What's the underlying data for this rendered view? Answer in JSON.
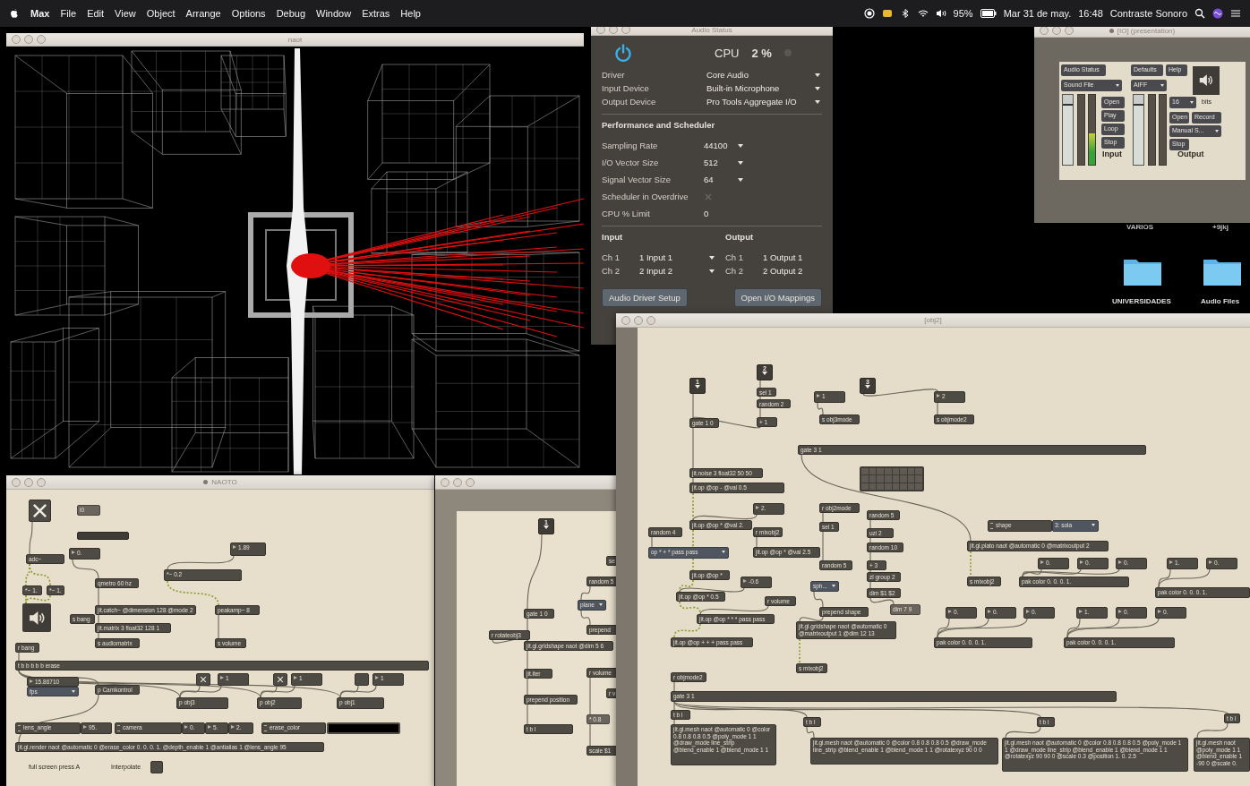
{
  "menu_bar": {
    "app": "Max",
    "menus": [
      "File",
      "Edit",
      "View",
      "Object",
      "Arrange",
      "Options",
      "Debug",
      "Window",
      "Extras",
      "Help"
    ],
    "battery": "95%",
    "date": "Mar 31 de may.",
    "time": "16:48",
    "user": "Contraste Sonoro"
  },
  "render_window": {
    "title": "naot"
  },
  "audio_status": {
    "title": "Audio Status",
    "power_on": true,
    "cpu_label": "CPU",
    "cpu_value": "2 %",
    "settings": [
      {
        "label": "Driver",
        "value": "Core Audio"
      },
      {
        "label": "Input Device",
        "value": "Built-in Microphone"
      },
      {
        "label": "Output Device",
        "value": "Pro Tools Aggregate I/O"
      }
    ],
    "section": "Performance and Scheduler",
    "perf": [
      {
        "kind": "menu",
        "label": "Sampling Rate",
        "value": "44100"
      },
      {
        "kind": "menu",
        "label": "I/O Vector Size",
        "value": "512"
      },
      {
        "kind": "menu",
        "label": "Signal Vector Size",
        "value": "64"
      },
      {
        "kind": "checkbox",
        "label": "Scheduler in Overdrive",
        "checked": true
      },
      {
        "kind": "number",
        "label": "CPU % Limit",
        "value": "0"
      }
    ],
    "io": [
      {
        "label": "Input",
        "channels": [
          {
            "ch": "Ch 1",
            "value": "1 Input 1"
          },
          {
            "ch": "Ch 2",
            "value": "2 Input 2"
          }
        ]
      },
      {
        "label": "Output",
        "channels": [
          {
            "ch": "Ch 1",
            "value": "1 Output 1"
          },
          {
            "ch": "Ch 2",
            "value": "2 Output 2"
          }
        ]
      }
    ],
    "buttons": [
      "Audio Driver Setup",
      "Open I/O Mappings"
    ]
  },
  "presentation": {
    "title": "[IO] (presentation)",
    "modified": true,
    "items": [
      {
        "kind": "button",
        "text": "Audio Status"
      },
      {
        "kind": "menu",
        "text": "Sound File"
      },
      {
        "kind": "button",
        "text": "Defaults"
      },
      {
        "kind": "button",
        "text": "Help"
      },
      {
        "kind": "menu",
        "text": "AIFF"
      },
      {
        "kind": "ezdac"
      },
      {
        "kind": "button",
        "text": "Open"
      },
      {
        "kind": "button",
        "text": "Play"
      },
      {
        "kind": "button",
        "text": "Loop"
      },
      {
        "kind": "button",
        "text": "Stop"
      },
      {
        "kind": "label",
        "text": "Input"
      },
      {
        "kind": "menu",
        "text": "16"
      },
      {
        "kind": "label",
        "text": "bits"
      },
      {
        "kind": "button",
        "text": "Open"
      },
      {
        "kind": "button",
        "text": "Record"
      },
      {
        "kind": "menu",
        "text": "Manual S..."
      },
      {
        "kind": "button",
        "text": "Stop"
      },
      {
        "kind": "label",
        "text": "Output"
      },
      {
        "kind": "gain",
        "level": 0.85
      },
      {
        "kind": "meter",
        "level": 0
      },
      {
        "kind": "meter",
        "level": 0.45
      },
      {
        "kind": "gain",
        "level": 0.85
      },
      {
        "kind": "meter",
        "level": 0
      },
      {
        "kind": "meter",
        "level": 0
      }
    ]
  },
  "desktop_items": [
    {
      "kind": "label",
      "text": "VARIOS"
    },
    {
      "kind": "label",
      "text": "+9jkj"
    },
    {
      "kind": "folder",
      "text": "UNIVERSIDADES"
    },
    {
      "kind": "folder",
      "text": "Audio Files"
    }
  ],
  "naoto": {
    "title": "NAOTO",
    "modified": true,
    "objects": [
      {
        "kind": "toggle",
        "checked": true
      },
      {
        "kind": "message",
        "text": "i0"
      },
      {
        "kind": "slider",
        "level": 0
      },
      {
        "kind": "number",
        "text": "0."
      },
      {
        "kind": "object",
        "text": "adc~"
      },
      {
        "kind": "object",
        "text": "*~ 1."
      },
      {
        "kind": "object",
        "text": "*~ 1."
      },
      {
        "kind": "ezdac"
      },
      {
        "kind": "number",
        "text": "1.89"
      },
      {
        "kind": "object",
        "text": "*~ 0.2"
      },
      {
        "kind": "object",
        "text": "qmetro 60 hz"
      },
      {
        "kind": "object",
        "text": "s bang"
      },
      {
        "kind": "object",
        "text": "jit.catch~ @dimension 128 @mode 2"
      },
      {
        "kind": "object",
        "text": "jit.matrix 3 float32 128 1"
      },
      {
        "kind": "object",
        "text": "s audiomatrix"
      },
      {
        "kind": "object",
        "text": "peakamp~ 8"
      },
      {
        "kind": "object",
        "text": "s volume"
      },
      {
        "kind": "object",
        "text": "r bang"
      },
      {
        "kind": "object",
        "text": "t b b b b b erase"
      },
      {
        "kind": "number",
        "text": "15.86710"
      },
      {
        "kind": "menu",
        "text": "fps"
      },
      {
        "kind": "object",
        "text": "p Camkontrol"
      },
      {
        "kind": "toggle",
        "checked": true
      },
      {
        "kind": "number",
        "text": "1"
      },
      {
        "kind": "object",
        "text": "p obj3"
      },
      {
        "kind": "toggle",
        "checked": true
      },
      {
        "kind": "number",
        "text": "1"
      },
      {
        "kind": "object",
        "text": "p obj2"
      },
      {
        "kind": "toggle",
        "checked": false
      },
      {
        "kind": "number",
        "text": "1"
      },
      {
        "kind": "object",
        "text": "p obj1"
      },
      {
        "kind": "attrui",
        "text": "lens_angle"
      },
      {
        "kind": "number",
        "text": "95."
      },
      {
        "kind": "attrui",
        "text": "camera"
      },
      {
        "kind": "number",
        "text": "0."
      },
      {
        "kind": "number",
        "text": "5."
      },
      {
        "kind": "number",
        "text": "2."
      },
      {
        "kind": "attrui",
        "text": "erase_color"
      },
      {
        "kind": "swatch"
      },
      {
        "kind": "object",
        "text": "jit.gl.render naot @automatic 0 @erase_color 0. 0. 0. 1. @depth_enable 1 @antialias 1 @lens_angle 95"
      },
      {
        "kind": "comment",
        "text": "full screen press A"
      },
      {
        "kind": "comment",
        "text": "Interpolate"
      },
      {
        "kind": "toggle",
        "checked": false
      }
    ]
  },
  "patcher_3": {
    "objects": [
      {
        "kind": "inlet",
        "text": "1"
      },
      {
        "kind": "object",
        "text": "se"
      },
      {
        "kind": "object",
        "text": "random 5"
      },
      {
        "kind": "menu",
        "text": "plane"
      },
      {
        "kind": "object",
        "text": "prepend"
      },
      {
        "kind": "object",
        "text": "gate 1 0"
      },
      {
        "kind": "object",
        "text": "r rotateobj3"
      },
      {
        "kind": "object",
        "text": "jit.gl.gridshape naot @dim 5 6"
      },
      {
        "kind": "object",
        "text": "jit.iter"
      },
      {
        "kind": "object",
        "text": "r volume"
      },
      {
        "kind": "object",
        "text": "r v"
      },
      {
        "kind": "object",
        "text": "prepend position"
      },
      {
        "kind": "message",
        "text": "* 0.8"
      },
      {
        "kind": "object",
        "text": "t b l"
      },
      {
        "kind": "object",
        "text": "scale $1"
      }
    ]
  },
  "obj2": {
    "title": "[obj2]",
    "objects": [
      {
        "kind": "inlet",
        "text": "1"
      },
      {
        "kind": "inlet",
        "text": "2"
      },
      {
        "kind": "inlet",
        "text": "3"
      },
      {
        "kind": "object",
        "text": "sel 1"
      },
      {
        "kind": "object",
        "text": "random 2"
      },
      {
        "kind": "object",
        "text": "gate 1 0"
      },
      {
        "kind": "object",
        "text": "+ 1"
      },
      {
        "kind": "number",
        "text": "1"
      },
      {
        "kind": "object",
        "text": "s obj3mode"
      },
      {
        "kind": "number",
        "text": "2"
      },
      {
        "kind": "object",
        "text": "s objmode2"
      },
      {
        "kind": "object",
        "text": "gate 3 1"
      },
      {
        "kind": "object",
        "text": "jit.noise 3 float32 50 50"
      },
      {
        "kind": "object",
        "text": "jit.op @op - @val 0.5"
      },
      {
        "kind": "matrix"
      },
      {
        "kind": "number",
        "text": "2."
      },
      {
        "kind": "object",
        "text": "r obj2mode"
      },
      {
        "kind": "object",
        "text": "random 5"
      },
      {
        "kind": "object",
        "text": "jit.op @op * @val 2."
      },
      {
        "kind": "object",
        "text": "random 4"
      },
      {
        "kind": "object",
        "text": "r mixobj2"
      },
      {
        "kind": "object",
        "text": "sel 1"
      },
      {
        "kind": "object",
        "text": "uzi 2"
      },
      {
        "kind": "attrui",
        "text": "shape"
      },
      {
        "kind": "menu",
        "text": "3: sola"
      },
      {
        "kind": "object",
        "text": "random 10"
      },
      {
        "kind": "object",
        "text": "jit.gl.plato naot @automatic 0 @matrixoutput 2"
      },
      {
        "kind": "menu",
        "text": "op * + * pass pass"
      },
      {
        "kind": "object",
        "text": "jit.op @op * @val 2.5"
      },
      {
        "kind": "object",
        "text": "random 5"
      },
      {
        "kind": "object",
        "text": "+ 3"
      },
      {
        "kind": "number",
        "text": "0."
      },
      {
        "kind": "number",
        "text": "0."
      },
      {
        "kind": "number",
        "text": "0."
      },
      {
        "kind": "number",
        "text": "1."
      },
      {
        "kind": "number",
        "text": "0."
      },
      {
        "kind": "object",
        "text": "jit.op @op *"
      },
      {
        "kind": "object",
        "text": "zl group 2"
      },
      {
        "kind": "number",
        "text": "-0.6"
      },
      {
        "kind": "object",
        "text": "s mixobj2"
      },
      {
        "kind": "object",
        "text": "pak color 0. 0. 0. 1."
      },
      {
        "kind": "menu",
        "text": "sph..."
      },
      {
        "kind": "object",
        "text": "dim $1 $2"
      },
      {
        "kind": "object",
        "text": "pak color 0. 0. 0. 1."
      },
      {
        "kind": "object",
        "text": "jit.op @op * 0.5"
      },
      {
        "kind": "object",
        "text": "r volume"
      },
      {
        "kind": "message",
        "text": "dim 7 9"
      },
      {
        "kind": "object",
        "text": "prepend shape"
      },
      {
        "kind": "number",
        "text": "0."
      },
      {
        "kind": "number",
        "text": "0."
      },
      {
        "kind": "number",
        "text": "0."
      },
      {
        "kind": "number",
        "text": "1."
      },
      {
        "kind": "number",
        "text": "0."
      },
      {
        "kind": "number",
        "text": "0."
      },
      {
        "kind": "object",
        "text": "jit.op @op * * * pass pass"
      },
      {
        "kind": "multi",
        "text": "jit.gl.gridshape naot @automatic 0 @matrixoutput 1 @dim 12 13"
      },
      {
        "kind": "object",
        "text": "jit.op @op + + + pass pass"
      },
      {
        "kind": "object",
        "text": "pak color 0. 0. 0. 1."
      },
      {
        "kind": "object",
        "text": "pak color 0. 0. 0. 1."
      },
      {
        "kind": "object",
        "text": "s mixobj2"
      },
      {
        "kind": "object",
        "text": "r objmode2"
      },
      {
        "kind": "object",
        "text": "gate 3 1"
      },
      {
        "kind": "object",
        "text": "t b l"
      },
      {
        "kind": "object",
        "text": "t b l"
      },
      {
        "kind": "object",
        "text": "t b l"
      },
      {
        "kind": "object",
        "text": "t b l"
      },
      {
        "kind": "multi",
        "text": "jit.gl.mesh naot @automatic 0 @color 0.8 0.8 0.8 0.5 @poly_mode 1 1 @draw_mode line_strip @blend_enable 1 @blend_mode 1 1"
      },
      {
        "kind": "multi",
        "text": "jit.gl.mesh naot @automatic 0 @color 0.8 0.8 0.8 0.5 @draw_mode line_strip @blend_enable 1 @blend_mode 1 1 @rotatexyz 90 0 0"
      },
      {
        "kind": "multi",
        "text": "jit.gl.mesh naot @automatic 0 @color 0.8 0.8 0.8 0.5 @poly_mode 1 1 @draw_mode line_strip @blend_enable 1 @blend_mode 1 1 @rotatexyz 90 90 0 @scale 0.3 @position 1. 0. 2.5"
      },
      {
        "kind": "multi",
        "text": "jit.gl.mesh naot @poly_mode 1 1 @blend_enable 1 -90 0 @scale 0."
      }
    ]
  }
}
